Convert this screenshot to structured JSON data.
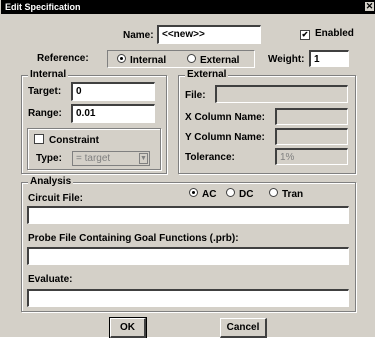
{
  "window": {
    "title": "Edit Specification",
    "close_glyph": "✕"
  },
  "header": {
    "name_label": "Name:",
    "name_value": "<<new>>",
    "enabled_label": "Enabled",
    "enabled_checked": true,
    "reference_label": "Reference:",
    "reference_options": [
      "Internal",
      "External"
    ],
    "reference_selected": "Internal",
    "weight_label": "Weight:",
    "weight_value": "1"
  },
  "internal": {
    "caption": "Internal",
    "target_label": "Target:",
    "target_value": "0",
    "range_label": "Range:",
    "range_value": "0.01",
    "constraint_label": "Constraint",
    "constraint_checked": false,
    "type_label": "Type:",
    "type_value": "= target"
  },
  "external": {
    "caption": "External",
    "file_label": "File:",
    "file_value": "",
    "xcol_label": "X Column Name:",
    "xcol_value": "",
    "ycol_label": "Y Column Name:",
    "ycol_value": "",
    "tolerance_label": "Tolerance:",
    "tolerance_value": "1%"
  },
  "analysis": {
    "caption": "Analysis",
    "modes": [
      "AC",
      "DC",
      "Tran"
    ],
    "mode_selected": "AC",
    "circuit_file_label": "Circuit File:",
    "circuit_file_value": "",
    "probe_file_label": "Probe File Containing Goal Functions (.prb):",
    "probe_file_value": "",
    "evaluate_label": "Evaluate:",
    "evaluate_value": ""
  },
  "buttons": {
    "ok": "OK",
    "cancel": "Cancel"
  }
}
